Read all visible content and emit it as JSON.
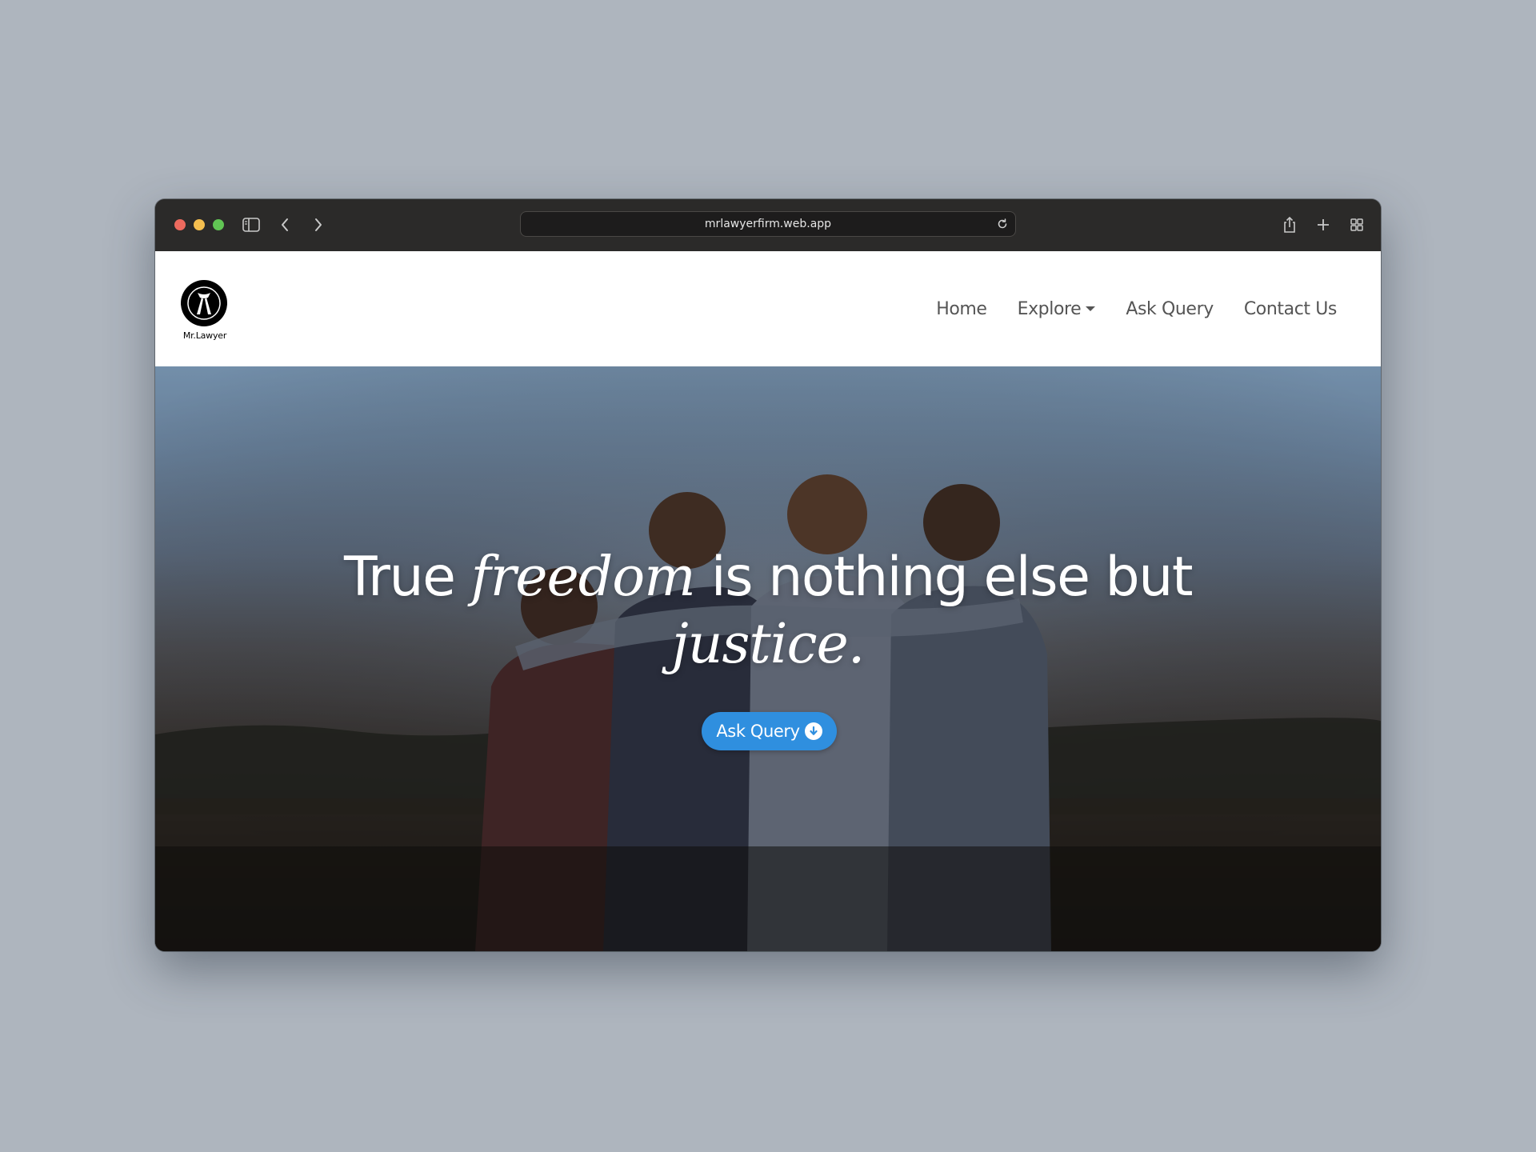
{
  "browser": {
    "url": "mrlawyerfirm.web.app"
  },
  "site": {
    "logo_text": "Mr.Lawyer",
    "nav": [
      {
        "label": "Home"
      },
      {
        "label": "Explore"
      },
      {
        "label": "Ask Query"
      },
      {
        "label": "Contact Us"
      }
    ]
  },
  "hero": {
    "headline_part1": "True ",
    "headline_italic1": "freedom",
    "headline_part2": " is nothing else but",
    "headline_italic2": "justice.",
    "cta_label": "Ask Query"
  },
  "colors": {
    "cta": "#2f8fdf",
    "nav_text": "#555555"
  },
  "icons": [
    "sidebar-icon",
    "back-icon",
    "forward-icon",
    "reload-icon",
    "share-icon",
    "new-tab-icon",
    "tab-overview-icon",
    "arrow-down-circle-icon"
  ]
}
